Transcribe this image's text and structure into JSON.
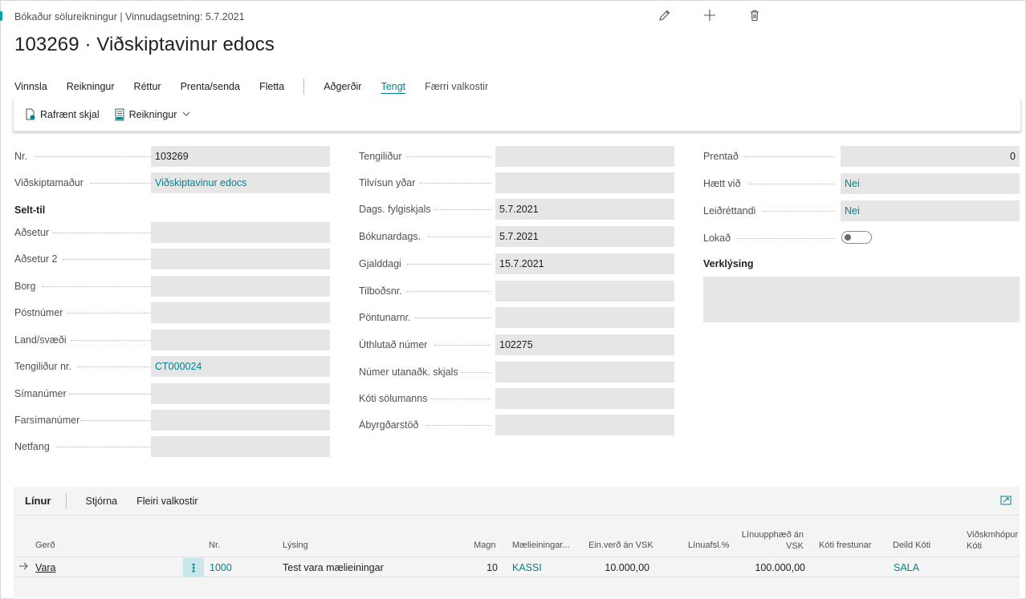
{
  "header": {
    "caption": "Bókaður sölureikningur | Vinnudagsetning: 5.7.2021",
    "title": "103269 · Viðskiptavinur edocs",
    "icons": [
      "edit-icon",
      "add-icon",
      "delete-icon"
    ]
  },
  "menu": {
    "items": [
      "Vinnsla",
      "Reikningur",
      "Réttur",
      "Prenta/senda",
      "Fletta",
      "Aðgerðir",
      "Tengt",
      "Færri valkostir"
    ],
    "active": "Tengt"
  },
  "actionbar": {
    "electronic_doc": "Rafrænt skjal",
    "invoice": "Reikningur"
  },
  "general": {
    "left": {
      "nr_label": "Nr.",
      "nr_value": "103269",
      "customer_label": "Viðskiptamaður",
      "customer_value": "Viðskiptavinur edocs",
      "sell_to_heading": "Selt-til",
      "address_label": "Aðsetur",
      "address_value": "",
      "address2_label": "Aðsetur 2",
      "address2_value": "",
      "city_label": "Borg",
      "city_value": "",
      "postcode_label": "Póstnúmer",
      "postcode_value": "",
      "country_label": "Land/svæði",
      "country_value": "",
      "contact_no_label": "Tengiliður nr.",
      "contact_no_value": "CT000024",
      "phone_label": "Símanúmer",
      "phone_value": "",
      "mobile_label": "Farsímanúmer",
      "mobile_value": "",
      "email_label": "Netfang",
      "email_value": ""
    },
    "middle": {
      "contact_label": "Tengiliður",
      "contact_value": "",
      "your_ref_label": "Tilvísun yðar",
      "your_ref_value": "",
      "doc_date_label": "Dags. fylgiskjals",
      "doc_date_value": "5.7.2021",
      "posting_date_label": "Bókunardags.",
      "posting_date_value": "5.7.2021",
      "due_date_label": "Gjalddagi",
      "due_date_value": "15.7.2021",
      "quote_no_label": "Tilboðsnr.",
      "quote_no_value": "",
      "order_no_label": "Pöntunarnr.",
      "order_no_value": "",
      "pre_assigned_label": "Úthlutað númer",
      "pre_assigned_value": "102275",
      "external_doc_label": "Númer utanaðk. skjals",
      "external_doc_value": "",
      "salesperson_label": "Kóti sölumanns",
      "salesperson_value": "",
      "resp_center_label": "Ábyrgðarstöð",
      "resp_center_value": ""
    },
    "right": {
      "printed_label": "Prentað",
      "printed_value": "0",
      "cancelled_label": "Hætt við",
      "cancelled_value": "Nei",
      "corrective_label": "Leiðréttandi",
      "corrective_value": "Nei",
      "closed_label": "Lokað",
      "closed_value": false,
      "work_desc_heading": "Verklýsing"
    }
  },
  "lines": {
    "title": "Línur",
    "menu": [
      "Stjórna",
      "Fleiri valkostir"
    ],
    "columns": {
      "type": "Gerð",
      "no": "Nr.",
      "description": "Lýsing",
      "quantity": "Magn",
      "uom": "Mælieiningar...",
      "unit_price": "Ein.verð án VSK",
      "discount": "Línuafsl.%",
      "amount_line1": "Línuupphæð án",
      "amount_line2": "VSK",
      "deferral": "Kóti frestunar",
      "dept_code": "Deild Kóti",
      "cust_group_line1": "Viðskmhópur",
      "cust_group_line2": "Kóti"
    },
    "rows": [
      {
        "type": "Vara",
        "no": "1000",
        "description": "Test vara mælieiningar",
        "quantity": "10",
        "uom": "KASSI",
        "unit_price": "10.000,00",
        "discount": "",
        "amount": "100.000,00",
        "deferral": "",
        "dept_code": "SALA",
        "cust_group": ""
      }
    ]
  },
  "colors": {
    "accent": "#00838f",
    "field_bg": "#e6e6e6",
    "row_menu_bg": "#c8e7ea"
  }
}
